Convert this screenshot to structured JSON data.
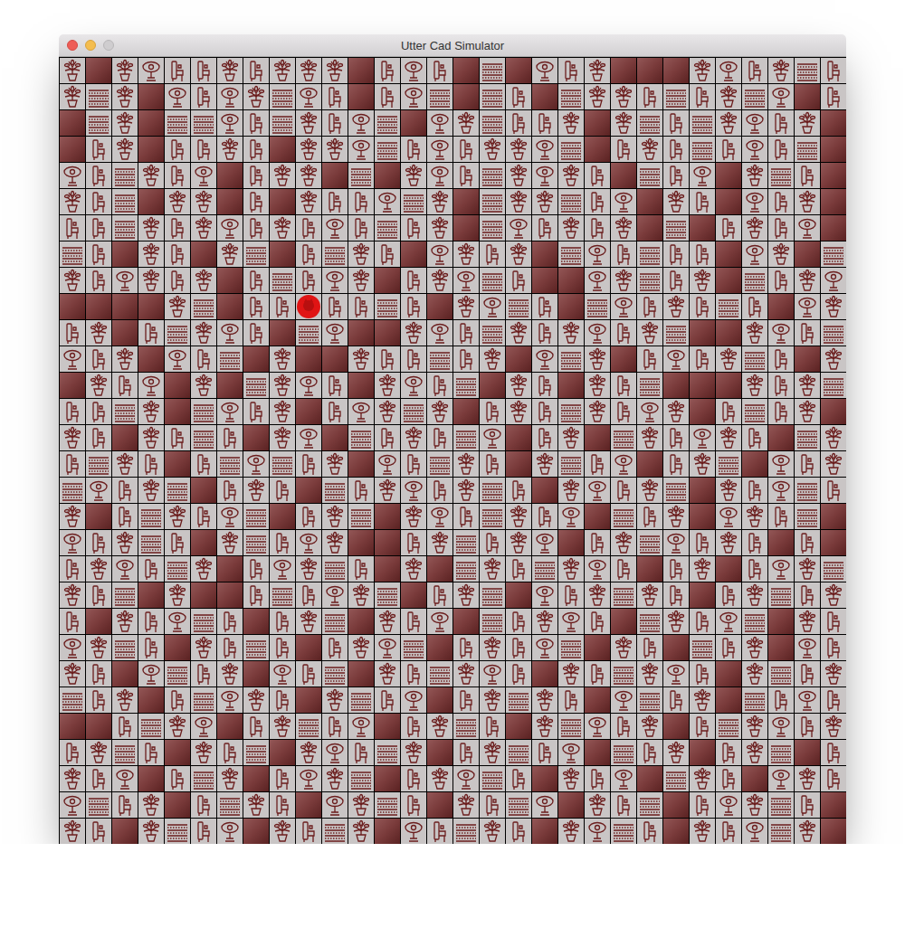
{
  "window": {
    "title": "Utter Cad Simulator"
  },
  "board": {
    "rows": [
      [
        "plant",
        "wall",
        "plant",
        "ring",
        "chair",
        "chair",
        "plant",
        "chair",
        "plant",
        "plant",
        "plant",
        "wall",
        "chair",
        "ring",
        "chair",
        "wall",
        "shelf",
        "wall",
        "ring",
        "chair",
        "plant",
        "wall",
        "wall",
        "wall",
        "plant",
        "ring",
        "chair",
        "plant",
        "shelf",
        "chair"
      ],
      [
        "plant",
        "shelf",
        "plant",
        "wall",
        "ring",
        "chair",
        "ring",
        "plant",
        "shelf",
        "ring",
        "chair",
        "wall",
        "chair",
        "ring",
        "shelf",
        "wall",
        "shelf",
        "chair",
        "wall",
        "shelf",
        "plant",
        "plant",
        "chair",
        "shelf",
        "chair",
        "plant",
        "shelf",
        "ring",
        "wall",
        "chair"
      ],
      [
        "wall",
        "shelf",
        "plant",
        "wall",
        "shelf",
        "shelf",
        "ring",
        "chair",
        "shelf",
        "plant",
        "chair",
        "ring",
        "shelf",
        "wall",
        "ring",
        "plant",
        "shelf",
        "chair",
        "chair",
        "plant",
        "wall",
        "plant",
        "shelf",
        "chair",
        "shelf",
        "plant",
        "ring",
        "chair",
        "plant",
        "wall"
      ],
      [
        "wall",
        "chair",
        "plant",
        "wall",
        "chair",
        "chair",
        "plant",
        "chair",
        "wall",
        "plant",
        "plant",
        "ring",
        "shelf",
        "chair",
        "ring",
        "chair",
        "plant",
        "plant",
        "ring",
        "shelf",
        "wall",
        "chair",
        "plant",
        "chair",
        "shelf",
        "chair",
        "ring",
        "chair",
        "shelf",
        "wall"
      ],
      [
        "ring",
        "chair",
        "shelf",
        "plant",
        "chair",
        "ring",
        "wall",
        "chair",
        "plant",
        "plant",
        "wall",
        "shelf",
        "wall",
        "plant",
        "ring",
        "chair",
        "shelf",
        "plant",
        "ring",
        "plant",
        "chair",
        "wall",
        "shelf",
        "chair",
        "ring",
        "wall",
        "plant",
        "shelf",
        "chair",
        "wall"
      ],
      [
        "plant",
        "chair",
        "shelf",
        "wall",
        "plant",
        "plant",
        "wall",
        "chair",
        "wall",
        "plant",
        "chair",
        "chair",
        "ring",
        "shelf",
        "plant",
        "wall",
        "shelf",
        "plant",
        "plant",
        "shelf",
        "chair",
        "ring",
        "wall",
        "plant",
        "chair",
        "wall",
        "ring",
        "chair",
        "plant",
        "wall"
      ],
      [
        "chair",
        "chair",
        "shelf",
        "plant",
        "chair",
        "plant",
        "ring",
        "chair",
        "plant",
        "chair",
        "ring",
        "chair",
        "shelf",
        "chair",
        "plant",
        "wall",
        "shelf",
        "ring",
        "chair",
        "plant",
        "chair",
        "plant",
        "wall",
        "shelf",
        "wall",
        "chair",
        "plant",
        "chair",
        "ring",
        "wall"
      ],
      [
        "shelf",
        "chair",
        "wall",
        "plant",
        "chair",
        "wall",
        "plant",
        "shelf",
        "wall",
        "chair",
        "shelf",
        "plant",
        "chair",
        "wall",
        "ring",
        "plant",
        "chair",
        "plant",
        "wall",
        "shelf",
        "ring",
        "chair",
        "shelf",
        "chair",
        "chair",
        "wall",
        "ring",
        "plant",
        "wall",
        "shelf"
      ],
      [
        "plant",
        "chair",
        "ring",
        "plant",
        "chair",
        "plant",
        "wall",
        "chair",
        "shelf",
        "chair",
        "ring",
        "plant",
        "wall",
        "chair",
        "plant",
        "ring",
        "shelf",
        "chair",
        "wall",
        "wall",
        "ring",
        "plant",
        "shelf",
        "chair",
        "plant",
        "wall",
        "shelf",
        "chair",
        "plant",
        "ring"
      ],
      [
        "wall",
        "wall",
        "wall",
        "wall",
        "plant",
        "shelf",
        "wall",
        "chair",
        "chair",
        "plant",
        "chair",
        "chair",
        "shelf",
        "chair",
        "wall",
        "plant",
        "ring",
        "shelf",
        "chair",
        "wall",
        "shelf",
        "ring",
        "chair",
        "plant",
        "chair",
        "shelf",
        "chair",
        "wall",
        "ring",
        "plant"
      ],
      [
        "chair",
        "plant",
        "wall",
        "chair",
        "shelf",
        "plant",
        "ring",
        "chair",
        "wall",
        "shelf",
        "ring",
        "wall",
        "wall",
        "plant",
        "ring",
        "chair",
        "shelf",
        "plant",
        "chair",
        "plant",
        "ring",
        "chair",
        "plant",
        "shelf",
        "wall",
        "wall",
        "plant",
        "ring",
        "chair",
        "shelf"
      ],
      [
        "ring",
        "chair",
        "plant",
        "wall",
        "ring",
        "chair",
        "shelf",
        "wall",
        "plant",
        "wall",
        "wall",
        "plant",
        "chair",
        "chair",
        "shelf",
        "chair",
        "plant",
        "wall",
        "ring",
        "shelf",
        "plant",
        "wall",
        "chair",
        "ring",
        "chair",
        "plant",
        "shelf",
        "chair",
        "wall",
        "plant"
      ],
      [
        "wall",
        "plant",
        "chair",
        "ring",
        "wall",
        "plant",
        "wall",
        "shelf",
        "plant",
        "ring",
        "chair",
        "wall",
        "plant",
        "ring",
        "chair",
        "shelf",
        "wall",
        "plant",
        "chair",
        "wall",
        "plant",
        "chair",
        "shelf",
        "wall",
        "wall",
        "wall",
        "plant",
        "chair",
        "plant",
        "shelf"
      ],
      [
        "chair",
        "chair",
        "shelf",
        "plant",
        "wall",
        "shelf",
        "ring",
        "chair",
        "plant",
        "wall",
        "chair",
        "ring",
        "plant",
        "shelf",
        "plant",
        "wall",
        "chair",
        "plant",
        "chair",
        "shelf",
        "plant",
        "chair",
        "ring",
        "plant",
        "wall",
        "chair",
        "shelf",
        "chair",
        "plant",
        "wall"
      ],
      [
        "plant",
        "chair",
        "wall",
        "plant",
        "chair",
        "shelf",
        "chair",
        "wall",
        "plant",
        "ring",
        "wall",
        "shelf",
        "chair",
        "plant",
        "chair",
        "shelf",
        "ring",
        "wall",
        "chair",
        "plant",
        "wall",
        "shelf",
        "plant",
        "chair",
        "ring",
        "plant",
        "chair",
        "wall",
        "shelf",
        "plant"
      ],
      [
        "chair",
        "shelf",
        "plant",
        "chair",
        "wall",
        "chair",
        "shelf",
        "ring",
        "shelf",
        "chair",
        "plant",
        "wall",
        "ring",
        "chair",
        "shelf",
        "plant",
        "chair",
        "wall",
        "plant",
        "shelf",
        "chair",
        "ring",
        "wall",
        "chair",
        "plant",
        "shelf",
        "wall",
        "ring",
        "chair",
        "plant"
      ],
      [
        "shelf",
        "ring",
        "chair",
        "plant",
        "shelf",
        "wall",
        "chair",
        "plant",
        "chair",
        "wall",
        "shelf",
        "chair",
        "plant",
        "ring",
        "chair",
        "plant",
        "shelf",
        "chair",
        "wall",
        "plant",
        "ring",
        "chair",
        "plant",
        "shelf",
        "wall",
        "plant",
        "chair",
        "ring",
        "shelf",
        "chair"
      ],
      [
        "plant",
        "wall",
        "chair",
        "shelf",
        "plant",
        "chair",
        "ring",
        "shelf",
        "wall",
        "chair",
        "plant",
        "shelf",
        "wall",
        "plant",
        "ring",
        "chair",
        "shelf",
        "plant",
        "chair",
        "ring",
        "wall",
        "shelf",
        "chair",
        "plant",
        "wall",
        "ring",
        "plant",
        "chair",
        "shelf",
        "wall"
      ],
      [
        "ring",
        "chair",
        "plant",
        "shelf",
        "chair",
        "wall",
        "plant",
        "shelf",
        "chair",
        "ring",
        "plant",
        "wall",
        "wall",
        "chair",
        "plant",
        "shelf",
        "chair",
        "plant",
        "ring",
        "wall",
        "chair",
        "plant",
        "shelf",
        "ring",
        "chair",
        "plant",
        "chair",
        "wall",
        "chair",
        "wall"
      ],
      [
        "chair",
        "plant",
        "ring",
        "chair",
        "shelf",
        "plant",
        "wall",
        "chair",
        "ring",
        "plant",
        "shelf",
        "chair",
        "wall",
        "plant",
        "wall",
        "shelf",
        "plant",
        "chair",
        "shelf",
        "plant",
        "ring",
        "chair",
        "wall",
        "chair",
        "plant",
        "wall",
        "chair",
        "ring",
        "plant",
        "shelf"
      ],
      [
        "plant",
        "chair",
        "shelf",
        "wall",
        "plant",
        "wall",
        "wall",
        "chair",
        "shelf",
        "chair",
        "ring",
        "plant",
        "shelf",
        "wall",
        "chair",
        "plant",
        "shelf",
        "wall",
        "ring",
        "chair",
        "plant",
        "shelf",
        "plant",
        "chair",
        "wall",
        "chair",
        "plant",
        "shelf",
        "chair",
        "plant"
      ],
      [
        "chair",
        "wall",
        "plant",
        "chair",
        "ring",
        "shelf",
        "chair",
        "wall",
        "chair",
        "plant",
        "shelf",
        "wall",
        "plant",
        "chair",
        "ring",
        "wall",
        "shelf",
        "chair",
        "plant",
        "ring",
        "chair",
        "wall",
        "shelf",
        "plant",
        "chair",
        "ring",
        "shelf",
        "wall",
        "plant",
        "chair"
      ],
      [
        "ring",
        "plant",
        "shelf",
        "chair",
        "wall",
        "plant",
        "chair",
        "shelf",
        "chair",
        "wall",
        "chair",
        "plant",
        "ring",
        "shelf",
        "wall",
        "chair",
        "plant",
        "chair",
        "ring",
        "shelf",
        "wall",
        "plant",
        "chair",
        "wall",
        "shelf",
        "chair",
        "plant",
        "wall",
        "ring",
        "chair"
      ],
      [
        "plant",
        "chair",
        "wall",
        "ring",
        "shelf",
        "chair",
        "plant",
        "wall",
        "ring",
        "chair",
        "shelf",
        "wall",
        "plant",
        "chair",
        "shelf",
        "plant",
        "ring",
        "chair",
        "wall",
        "plant",
        "chair",
        "shelf",
        "plant",
        "ring",
        "chair",
        "wall",
        "plant",
        "shelf",
        "chair",
        "plant"
      ],
      [
        "shelf",
        "chair",
        "plant",
        "wall",
        "chair",
        "shelf",
        "ring",
        "plant",
        "chair",
        "wall",
        "plant",
        "shelf",
        "chair",
        "ring",
        "wall",
        "chair",
        "plant",
        "shelf",
        "plant",
        "chair",
        "wall",
        "ring",
        "shelf",
        "chair",
        "plant",
        "wall",
        "shelf",
        "chair",
        "ring",
        "chair"
      ],
      [
        "wall",
        "wall",
        "chair",
        "shelf",
        "plant",
        "ring",
        "wall",
        "chair",
        "plant",
        "shelf",
        "chair",
        "ring",
        "wall",
        "chair",
        "plant",
        "shelf",
        "chair",
        "wall",
        "plant",
        "shelf",
        "ring",
        "chair",
        "plant",
        "wall",
        "chair",
        "shelf",
        "plant",
        "ring",
        "chair",
        "plant"
      ],
      [
        "chair",
        "plant",
        "shelf",
        "chair",
        "wall",
        "plant",
        "chair",
        "shelf",
        "wall",
        "plant",
        "ring",
        "chair",
        "shelf",
        "plant",
        "wall",
        "chair",
        "plant",
        "shelf",
        "chair",
        "ring",
        "wall",
        "shelf",
        "chair",
        "plant",
        "wall",
        "chair",
        "plant",
        "shelf",
        "wall",
        "chair"
      ],
      [
        "plant",
        "chair",
        "ring",
        "wall",
        "chair",
        "shelf",
        "plant",
        "wall",
        "chair",
        "ring",
        "plant",
        "shelf",
        "wall",
        "chair",
        "plant",
        "ring",
        "shelf",
        "chair",
        "wall",
        "plant",
        "chair",
        "ring",
        "wall",
        "shelf",
        "plant",
        "chair",
        "wall",
        "ring",
        "plant",
        "chair"
      ],
      [
        "ring",
        "shelf",
        "chair",
        "plant",
        "wall",
        "chair",
        "shelf",
        "plant",
        "chair",
        "wall",
        "ring",
        "plant",
        "shelf",
        "chair",
        "wall",
        "plant",
        "chair",
        "shelf",
        "ring",
        "wall",
        "plant",
        "chair",
        "shelf",
        "wall",
        "chair",
        "ring",
        "plant",
        "shelf",
        "chair",
        "wall"
      ],
      [
        "plant",
        "chair",
        "wall",
        "plant",
        "shelf",
        "chair",
        "ring",
        "wall",
        "plant",
        "chair",
        "shelf",
        "plant",
        "wall",
        "ring",
        "chair",
        "shelf",
        "plant",
        "chair",
        "wall",
        "plant",
        "ring",
        "shelf",
        "chair",
        "wall",
        "plant",
        "chair",
        "ring",
        "shelf",
        "plant",
        "wall"
      ]
    ]
  },
  "player": {
    "row": 9,
    "col": 9
  }
}
